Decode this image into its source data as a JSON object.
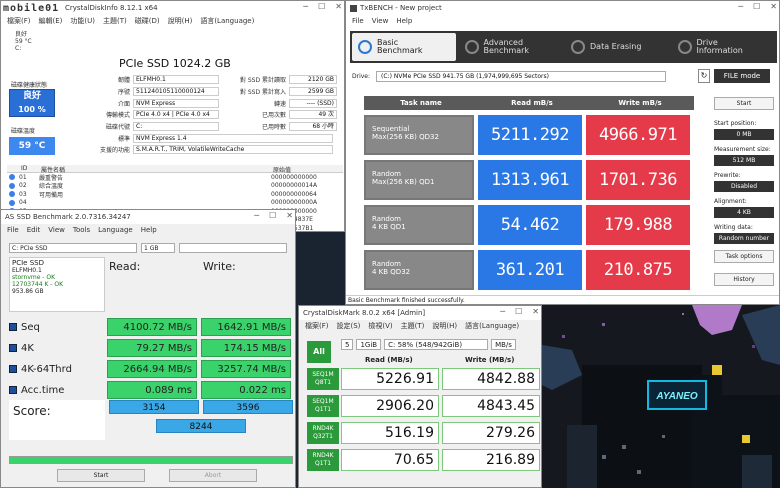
{
  "cdi": {
    "title": "CrystalDiskInfo 8.12.1 x64",
    "watermark": "mobile01",
    "menu": [
      "檔案(F)",
      "編輯(E)",
      "功能(U)",
      "主題(T)",
      "磁碟(D)",
      "說明(H)",
      "語言(Language)"
    ],
    "drive_status": "良好",
    "drive_temp": "59 °C",
    "drive_letter": "C:",
    "model": "PCIe SSD 1024.2 GB",
    "health_label": "磁碟健康狀態",
    "health_value": "良好",
    "health_pct": "100 %",
    "temp_label": "磁碟溫度",
    "temp_value": "59 °C",
    "left_info": [
      {
        "k": "韌體",
        "v": "ELFMH0.1"
      },
      {
        "k": "序號",
        "v": "511240105110000124"
      },
      {
        "k": "介面",
        "v": "NVM Express"
      },
      {
        "k": "傳輸模式",
        "v": "PCIe 4.0 x4 | PCIe 4.0 x4"
      },
      {
        "k": "磁碟代號",
        "v": "C:"
      },
      {
        "k": "標準",
        "v": "NVM Express 1.4"
      }
    ],
    "right_info": [
      {
        "k": "對 SSD 累計讀取",
        "v": "2120 GB"
      },
      {
        "k": "對 SSD 累計寫入",
        "v": "2599 GB"
      },
      {
        "k": "轉速",
        "v": "---- (SSD)"
      },
      {
        "k": "已用次數",
        "v": "49 次"
      },
      {
        "k": "已用時數",
        "v": "68 小時"
      }
    ],
    "features_label": "支援的功能",
    "features": "S.M.A.R.T., TRIM, VolatileWriteCache",
    "attr_headers": [
      "ID",
      "屬性名稱",
      "原始值"
    ],
    "attrs": [
      {
        "id": "01",
        "name": "嚴重警告",
        "raw": "000000000000"
      },
      {
        "id": "02",
        "name": "綜合溫度",
        "raw": "00000000014A"
      },
      {
        "id": "03",
        "name": "可用備用",
        "raw": "000000000064"
      },
      {
        "id": "04",
        "name": "",
        "raw": "00000000000A"
      },
      {
        "id": "05",
        "name": "",
        "raw": "000000000000"
      },
      {
        "id": "06",
        "name": "",
        "raw": "0000004837E"
      },
      {
        "id": "07",
        "name": "",
        "raw": "000000537B1"
      },
      {
        "id": "08",
        "name": "",
        "raw": "0000DBA99"
      },
      {
        "id": "09",
        "name": "",
        "raw": "000000DC29C"
      },
      {
        "id": "0A",
        "name": "",
        "raw": "0000000000"
      },
      {
        "id": "0B",
        "name": "",
        "raw": "000000031"
      },
      {
        "id": "0C",
        "name": "",
        "raw": "000000044"
      },
      {
        "id": "0D",
        "name": "",
        "raw": "00000000"
      },
      {
        "id": "0E",
        "name": "",
        "raw": "00000000"
      },
      {
        "id": "0F",
        "name": "",
        "raw": "00000000"
      }
    ]
  },
  "tx": {
    "title": "TxBENCH - New project",
    "menu": [
      "File",
      "View",
      "Help"
    ],
    "tabs": [
      {
        "label": "Basic\nBenchmark",
        "icon": "gauge-icon"
      },
      {
        "label": "Advanced\nBenchmark",
        "icon": "chart-icon"
      },
      {
        "label": "Data Erasing",
        "icon": "erase-icon"
      },
      {
        "label": "Drive\nInformation",
        "icon": "info-icon"
      }
    ],
    "drive_label": "Drive:",
    "drive_value": "(C:) NVMe PCIe SSD   941.75 GB (1,974,999,695 Sectors)",
    "file_mode": "FILE mode",
    "headers": [
      "Task name",
      "Read mB/s",
      "Write mB/s"
    ],
    "rows": [
      {
        "task": "Sequential\nMax(256 KB) QD32",
        "read": "5211.292",
        "write": "4966.971"
      },
      {
        "task": "Random\nMax(256 KB) QD1",
        "read": "1313.961",
        "write": "1701.736"
      },
      {
        "task": "Random\n4 KB QD1",
        "read": "54.462",
        "write": "179.988"
      },
      {
        "task": "Random\n4 KB QD32",
        "read": "361.201",
        "write": "210.875"
      }
    ],
    "start": "Start",
    "start_position_label": "Start position:",
    "start_position": "0 MB",
    "measurement_size_label": "Measurement size:",
    "measurement_size": "512 MB",
    "prewrite_label": "Prewrite:",
    "prewrite": "Disabled",
    "alignment_label": "Alignment:",
    "alignment": "4 KB",
    "writing_data_label": "Writing data:",
    "writing_data": "Random number",
    "task_options": "Task options",
    "history": "History",
    "status": "Basic Benchmark finished successfully."
  },
  "as": {
    "title": "AS SSD Benchmark 2.0.7316.34247",
    "menu": [
      "File",
      "Edit",
      "View",
      "Tools",
      "Language",
      "Help"
    ],
    "drive": "C: PCIe SSD",
    "size": "1 GB",
    "model": "PCIe SSD",
    "fw": "ELFMH0.1",
    "driver": "stornvme - OK",
    "align": "12703744 K - OK",
    "capacity": "953.86 GB",
    "read_header": "Read:",
    "write_header": "Write:",
    "rows": [
      {
        "label": "Seq",
        "read": "4100.72 MB/s",
        "write": "1642.91 MB/s"
      },
      {
        "label": "4K",
        "read": "79.27 MB/s",
        "write": "174.15 MB/s"
      },
      {
        "label": "4K-64Thrd",
        "read": "2664.94 MB/s",
        "write": "3257.74 MB/s"
      },
      {
        "label": "Acc.time",
        "read": "0.089 ms",
        "write": "0.022 ms"
      }
    ],
    "score_label": "Score:",
    "score_read": "3154",
    "score_write": "3596",
    "score_total": "8244",
    "start": "Start",
    "abort": "Abort"
  },
  "cdm": {
    "title": "CrystalDiskMark 8.0.2 x64 [Admin]",
    "menu": [
      "檔案(F)",
      "設定(S)",
      "檢視(V)",
      "主題(T)",
      "說明(H)",
      "語言(Language)"
    ],
    "all": "All",
    "count": "5",
    "size": "1GiB",
    "drive": "C: 58% (548/942GiB)",
    "unit": "MB/s",
    "read_header": "Read (MB/s)",
    "write_header": "Write (MB/s)",
    "rows": [
      {
        "l1": "SEQ1M",
        "l2": "Q8T1",
        "read": "5226.91",
        "write": "4842.88"
      },
      {
        "l1": "SEQ1M",
        "l2": "Q1T1",
        "read": "2906.20",
        "write": "4843.45"
      },
      {
        "l1": "RND4K",
        "l2": "Q32T1",
        "read": "516.19",
        "write": "279.26"
      },
      {
        "l1": "RND4K",
        "l2": "Q1T1",
        "read": "70.65",
        "write": "216.89"
      }
    ]
  },
  "art": {
    "sign": "AYANEO"
  }
}
